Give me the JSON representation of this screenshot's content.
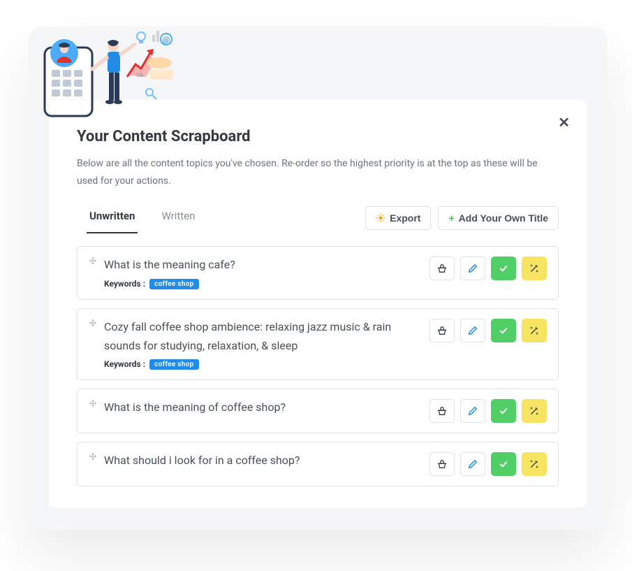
{
  "modal": {
    "title": "Your Content Scrapboard",
    "description": "Below are all the content topics you've chosen. Re-order so the highest priority is at the top as these will be used for your actions."
  },
  "tabs": [
    {
      "label": "Unwritten",
      "active": true
    },
    {
      "label": "Written",
      "active": false
    }
  ],
  "buttons": {
    "export": "Export",
    "add_title": "Add Your Own Title"
  },
  "keywords_label": "Keywords :",
  "items": [
    {
      "title": "What is the meaning cafe?",
      "keywords": [
        "coffee shop"
      ]
    },
    {
      "title": "Cozy fall coffee shop ambience: relaxing jazz music & rain sounds for studying, relaxation, & sleep",
      "keywords": [
        "coffee shop"
      ]
    },
    {
      "title": "What is the meaning of coffee shop?",
      "keywords": []
    },
    {
      "title": "What should i look for in a coffee shop?",
      "keywords": []
    }
  ]
}
